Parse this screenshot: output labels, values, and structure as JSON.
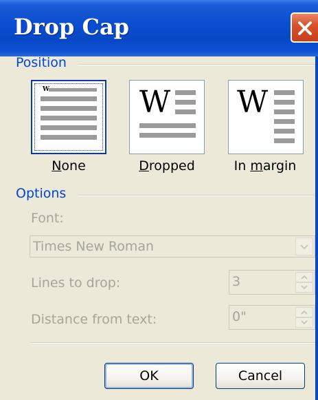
{
  "dialog": {
    "title": "Drop Cap"
  },
  "position": {
    "group_label": "Position",
    "options": [
      {
        "label": "None",
        "mnemonic": "N",
        "icon": "drop-cap-none-icon",
        "selected": true
      },
      {
        "label": "Dropped",
        "mnemonic": "D",
        "icon": "drop-cap-dropped-icon",
        "selected": false
      },
      {
        "label": "In margin",
        "mnemonic": "m",
        "icon": "drop-cap-in-margin-icon",
        "selected": false
      }
    ],
    "preview_letter": "W"
  },
  "options": {
    "group_label": "Options",
    "font_label": "Font:",
    "font_value": "Times New Roman",
    "lines_label": "Lines to drop:",
    "lines_value": "3",
    "distance_label": "Distance from text:",
    "distance_value": "0\""
  },
  "buttons": {
    "ok": "OK",
    "cancel": "Cancel"
  },
  "colors": {
    "titlebar": "#0848c6",
    "group_label": "#0046d5",
    "disabled_text": "#a6a59a",
    "dialog_bg": "#ece9d8"
  }
}
